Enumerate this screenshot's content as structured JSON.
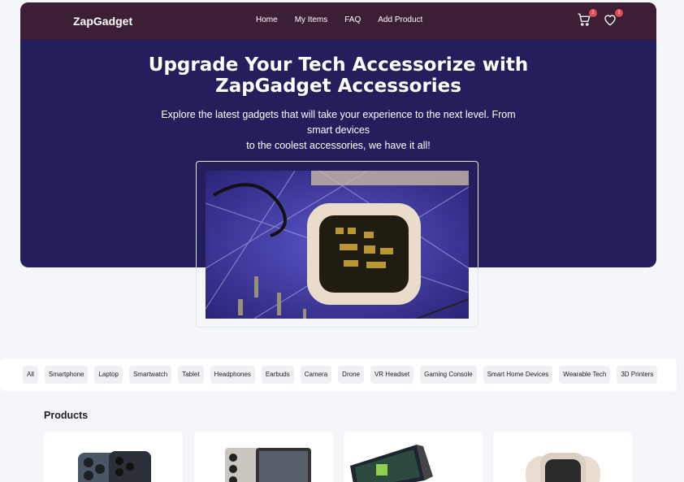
{
  "brand": {
    "name": "ZapGadget"
  },
  "nav": {
    "links": [
      "Home",
      "My Items",
      "FAQ",
      "Add Product"
    ],
    "cart_count": "2",
    "wishlist_count": "1"
  },
  "hero": {
    "title_line1": "Upgrade Your Tech Accessorize with",
    "title_line2": "ZapGadget Accessories",
    "subtitle_line1": "Explore the latest gadgets that will take your experience to the next level. From smart devices",
    "subtitle_line2": "to the coolest accessories, we have it all!"
  },
  "categories": [
    "All",
    "Smartphone",
    "Laptop",
    "Smartwatch",
    "Tablet",
    "Headphones",
    "Earbuds",
    "Camera",
    "Drone",
    "VR Headset",
    "Gaming Console",
    "Smart Home Devices",
    "Wearable Tech",
    "3D Printers"
  ],
  "products": {
    "heading": "Products"
  },
  "colors": {
    "hero_bg": "#231f5c",
    "navbar_bg": "#3d1f35",
    "badge": "#e5484d"
  }
}
